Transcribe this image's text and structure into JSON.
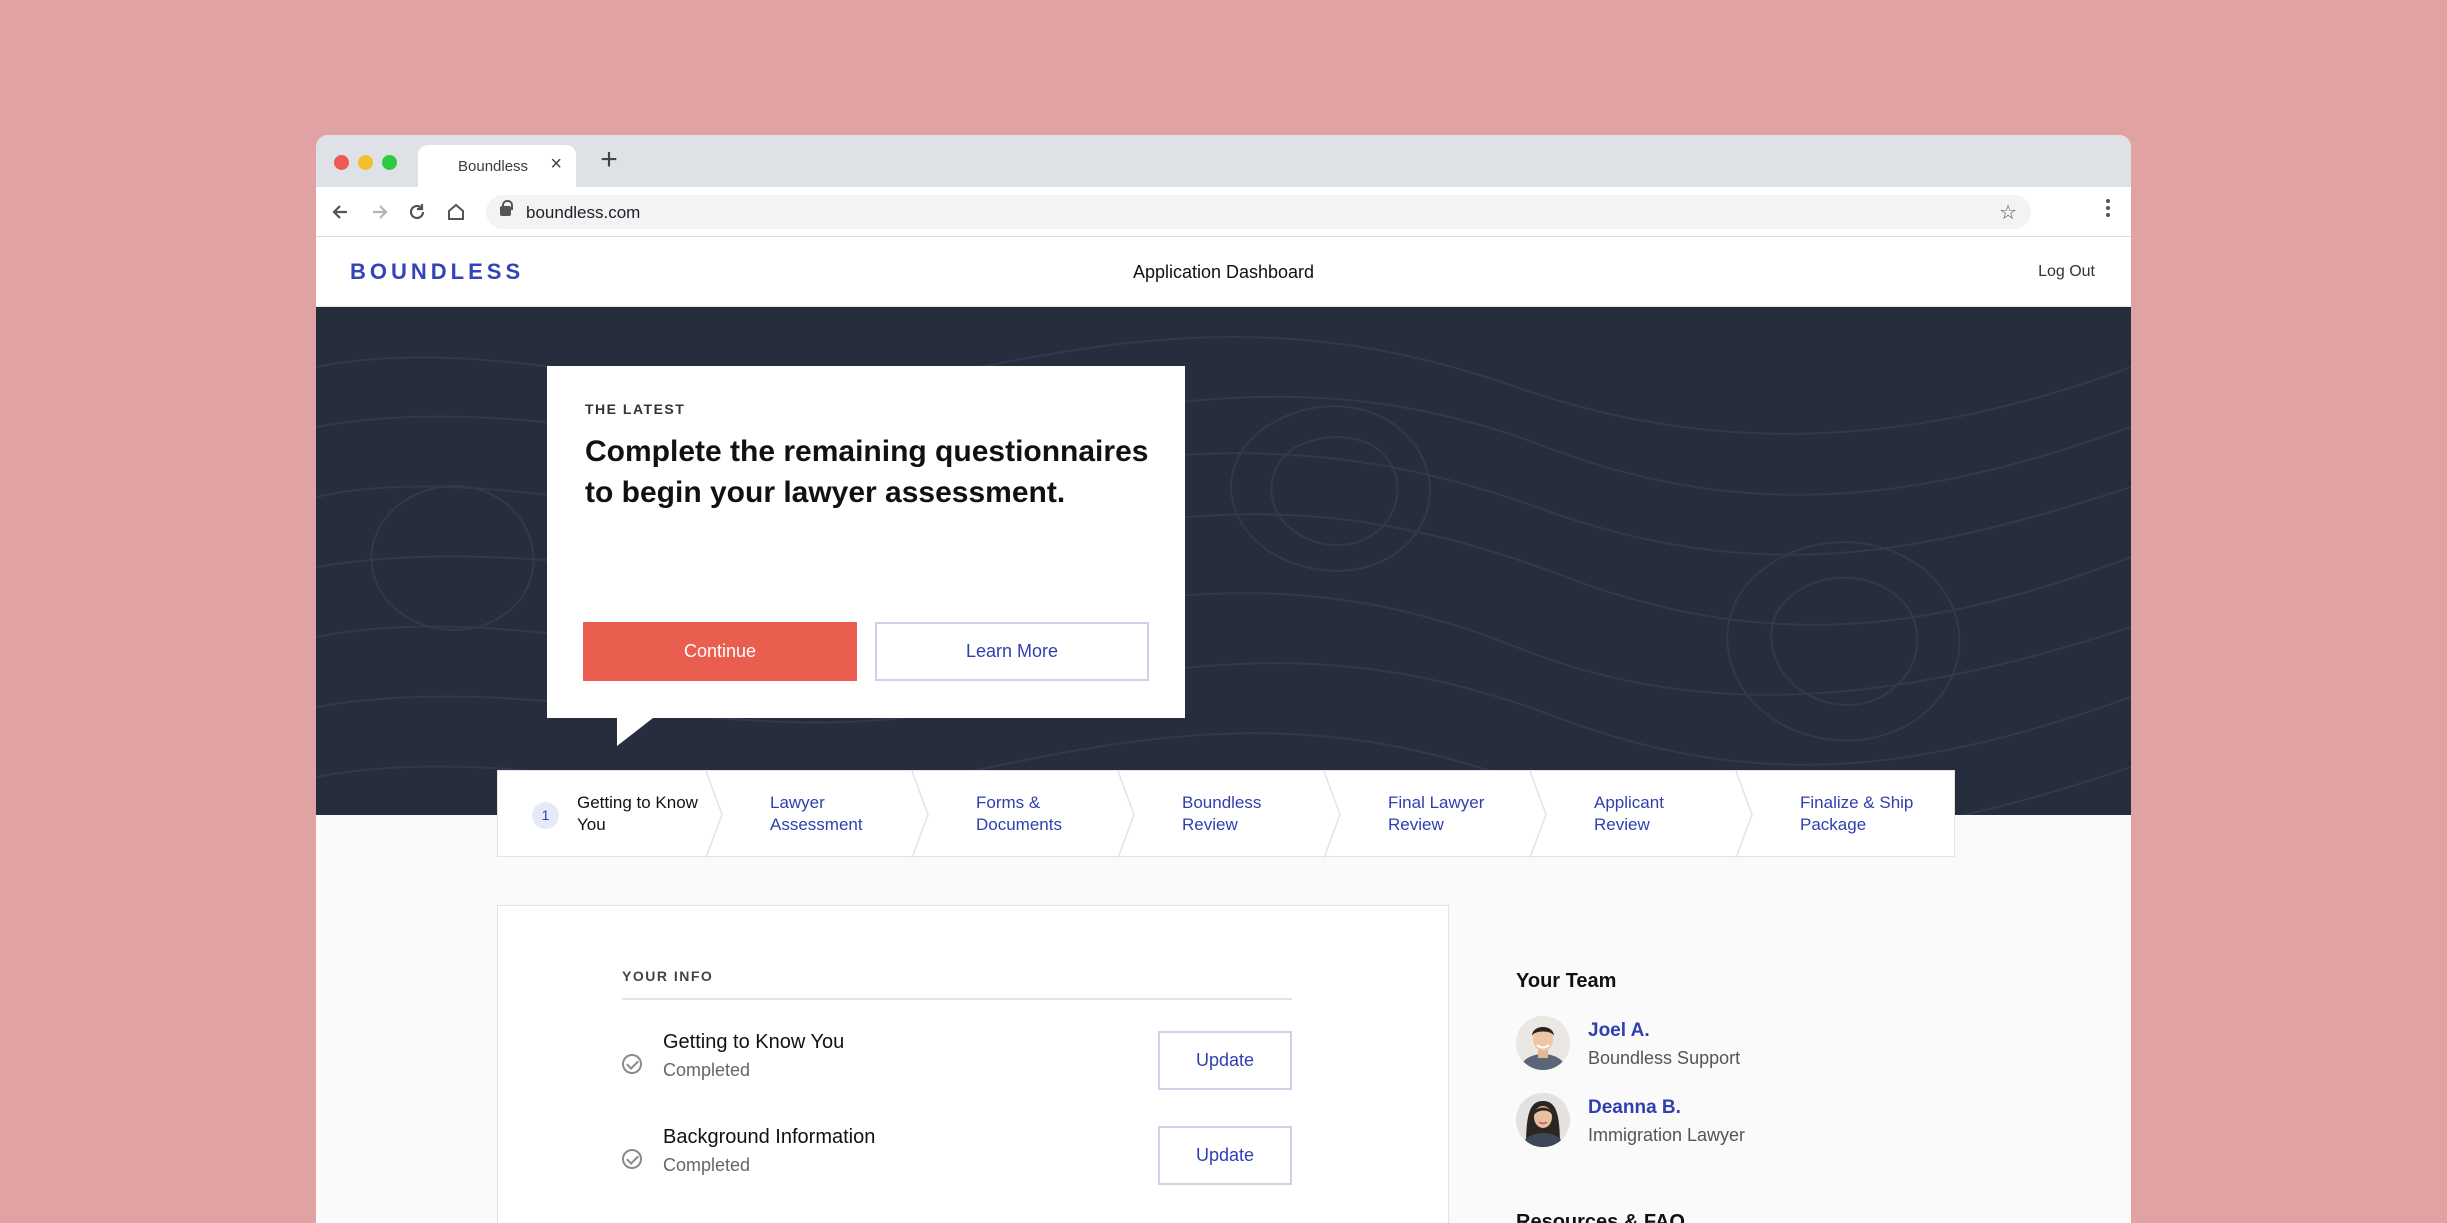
{
  "browser": {
    "tab_title": "Boundless",
    "tab_close_glyph": "×",
    "new_tab_glyph": "+",
    "url": "boundless.com",
    "icons": [
      "back-icon",
      "forward-icon",
      "reload-icon",
      "home-icon",
      "lock-icon",
      "star-icon",
      "more-icon"
    ]
  },
  "header": {
    "logo": "BOUNDLESS",
    "title": "Application Dashboard",
    "logout": "Log Out"
  },
  "hero": {
    "eyebrow": "THE LATEST",
    "heading": "Complete the remaining questionnaires to begin your lawyer assessment.",
    "continue_label": "Continue",
    "learn_more_label": "Learn More"
  },
  "stepper": {
    "active_number": "1",
    "steps": [
      {
        "label": "Getting to Know You"
      },
      {
        "label": "Lawyer Assessment"
      },
      {
        "label": "Forms & Documents"
      },
      {
        "label": "Boundless Review"
      },
      {
        "label": "Final Lawyer Review"
      },
      {
        "label": "Applicant Review"
      },
      {
        "label": "Finalize & Ship Package"
      }
    ]
  },
  "your_info": {
    "title": "YOUR INFO",
    "rows": [
      {
        "title": "Getting to Know You",
        "status": "Completed",
        "button": "Update"
      },
      {
        "title": "Background Information",
        "status": "Completed",
        "button": "Update"
      }
    ]
  },
  "team": {
    "title": "Your Team",
    "members": [
      {
        "name": "Joel A.",
        "role": "Boundless Support"
      },
      {
        "name": "Deanna B.",
        "role": "Immigration Lawyer"
      }
    ],
    "next_section_peek": "Resources & FAQ"
  },
  "colors": {
    "page_bg": "#e1a2a3",
    "brand_blue": "#2f3fb0",
    "hero_bg": "#262d3c",
    "continue_red": "#ea5e50"
  }
}
